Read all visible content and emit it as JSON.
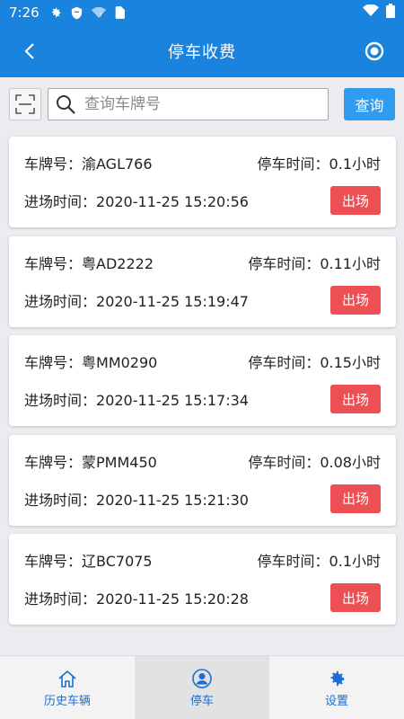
{
  "statusbar": {
    "time": "7:26"
  },
  "header": {
    "title": "停车收费"
  },
  "search": {
    "placeholder": "查询车牌号",
    "button_label": "查询"
  },
  "records": [
    {
      "plate_label": "车牌号：",
      "plate": "渝AGL766",
      "duration_label": "停车时间：",
      "duration": "0.1小时",
      "entry_label": "进场时间：",
      "entry_time": "2020-11-25 15:20:56",
      "exit_label": "出场"
    },
    {
      "plate_label": "车牌号：",
      "plate": "粤AD2222",
      "duration_label": "停车时间：",
      "duration": "0.11小时",
      "entry_label": "进场时间：",
      "entry_time": "2020-11-25 15:19:47",
      "exit_label": "出场"
    },
    {
      "plate_label": "车牌号：",
      "plate": "粤MM0290",
      "duration_label": "停车时间：",
      "duration": "0.15小时",
      "entry_label": "进场时间：",
      "entry_time": "2020-11-25 15:17:34",
      "exit_label": "出场"
    },
    {
      "plate_label": "车牌号：",
      "plate": "蒙PMM450",
      "duration_label": "停车时间：",
      "duration": "0.08小时",
      "entry_label": "进场时间：",
      "entry_time": "2020-11-25 15:21:30",
      "exit_label": "出场"
    },
    {
      "plate_label": "车牌号：",
      "plate": "辽BC7075",
      "duration_label": "停车时间：",
      "duration": "0.1小时",
      "entry_label": "进场时间：",
      "entry_time": "2020-11-25 15:20:28",
      "exit_label": "出场"
    }
  ],
  "tabs": [
    {
      "label": "历史车辆",
      "icon": "home-icon"
    },
    {
      "label": "停车",
      "icon": "user-icon"
    },
    {
      "label": "设置",
      "icon": "gear-icon"
    }
  ],
  "colors": {
    "primary": "#1a83de",
    "button": "#2f9cf0",
    "danger": "#ec4f54",
    "tab_text": "#1a6fd0"
  }
}
